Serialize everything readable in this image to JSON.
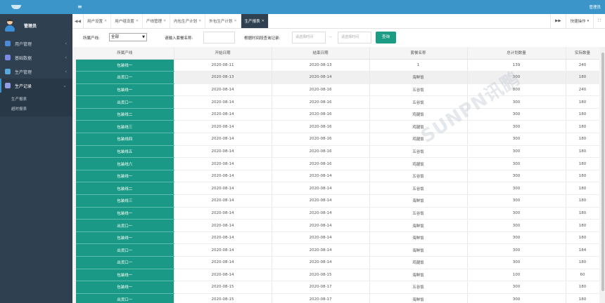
{
  "app": {
    "username": "管理员",
    "topbar_user": "管理员",
    "hamburger": "≡"
  },
  "sidebar": {
    "items": [
      {
        "label": "用户管理",
        "icon": "user-icon",
        "color": "#4a8ad8",
        "arrow": "‹"
      },
      {
        "label": "基础数据",
        "icon": "database-icon",
        "color": "#7a88e6",
        "arrow": "‹"
      },
      {
        "label": "生产管理",
        "icon": "wrench-icon",
        "color": "#55aadd",
        "arrow": "‹"
      },
      {
        "label": "生产记录",
        "icon": "record-icon",
        "color": "#8f9ce8",
        "arrow": "⌄"
      }
    ],
    "sub_items": [
      "生产报表",
      "超时报表"
    ]
  },
  "tabs": {
    "scroll_left": "◀◀",
    "scroll_right": "▶▶",
    "items": [
      "用户设置",
      "用户组设置",
      "产线管理",
      "内包生产计划",
      "外包生产计划",
      "生产报表"
    ],
    "close": "✕",
    "active_index": 5,
    "quick_ops": "快捷操作",
    "expand": "⛶"
  },
  "filters": {
    "line_label": "所属产线:",
    "line_value": "全部",
    "meal_label": "请输入套餐名称:",
    "meal_value": "",
    "range_label": "根据时间段查询记录:",
    "start_placeholder": "请选择时间",
    "separator": "--",
    "end_placeholder": "请选择时间",
    "query_button": "查询"
  },
  "table": {
    "headers": [
      "所属产线",
      "开始日期",
      "结束日期",
      "套餐名称",
      "总计划数量",
      "实际数量"
    ],
    "rows": [
      [
        "包装线一",
        "2020-08-11",
        "2020-08-13",
        "1",
        "139",
        "240"
      ],
      [
        "出货口一",
        "2020-08-13",
        "2020-08-14",
        "海鲜饭",
        "300",
        "180"
      ],
      [
        "包装线一",
        "2020-08-14",
        "2020-08-16",
        "五谷饭",
        "800",
        "240"
      ],
      [
        "出货口一",
        "2020-08-14",
        "2020-08-16",
        "五谷饭",
        "300",
        "180"
      ],
      [
        "包装线二",
        "2020-08-14",
        "2020-08-16",
        "鸡腿饭",
        "300",
        "180"
      ],
      [
        "包装线三",
        "2020-08-14",
        "2020-08-16",
        "鸡腿饭",
        "300",
        "180"
      ],
      [
        "包装线四",
        "2020-08-14",
        "2020-08-16",
        "鸡腿饭",
        "300",
        "180"
      ],
      [
        "包装线五",
        "2020-08-14",
        "2020-08-16",
        "五谷饭",
        "300",
        "180"
      ],
      [
        "包装线六",
        "2020-08-14",
        "2020-08-16",
        "鸡腿饭",
        "300",
        "180"
      ],
      [
        "包装线一",
        "2020-08-14",
        "2020-08-14",
        "五谷饭",
        "300",
        "180"
      ],
      [
        "包装线二",
        "2020-08-14",
        "2020-08-14",
        "五谷饭",
        "300",
        "180"
      ],
      [
        "包装线三",
        "2020-08-14",
        "2020-08-14",
        "海鲜饭",
        "300",
        "180"
      ],
      [
        "包装线一",
        "2020-08-14",
        "2020-08-14",
        "五谷饭",
        "300",
        "180"
      ],
      [
        "出货口一",
        "2020-08-14",
        "2020-08-14",
        "海鲜饭",
        "300",
        "180"
      ],
      [
        "包装线一",
        "2020-08-14",
        "2020-08-14",
        "海鲜饭",
        "300",
        "180"
      ],
      [
        "出货口一",
        "2020-08-14",
        "2020-08-14",
        "海鲜饭",
        "300",
        "184"
      ],
      [
        "出货口一",
        "2020-08-14",
        "2020-08-14",
        "鸡腿饭",
        "300",
        "180"
      ],
      [
        "包装线一",
        "2020-08-14",
        "2020-08-15",
        "海鲜饭",
        "100",
        "60"
      ],
      [
        "包装线一",
        "2020-08-15",
        "2020-08-17",
        "五谷饭",
        "300",
        "180"
      ],
      [
        "出货口一",
        "2020-08-15",
        "2020-08-17",
        "海鲜饭",
        "300",
        "180"
      ]
    ],
    "highlight_row": 1
  },
  "watermark": "SUNPN讯鹏",
  "colors": {
    "sidebar_bg": "#2f4050",
    "topbar_bg": "#3b95c9",
    "accent_green": "#1a9a86"
  }
}
